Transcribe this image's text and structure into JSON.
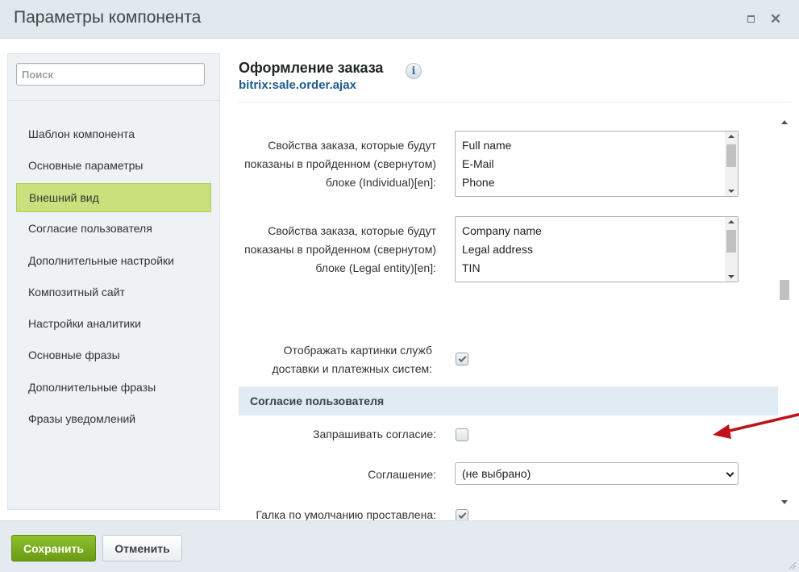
{
  "window": {
    "title": "Параметры компонента"
  },
  "sidebar": {
    "search_placeholder": "Поиск",
    "items": [
      {
        "label": "Шаблон компонента"
      },
      {
        "label": "Основные параметры"
      },
      {
        "label": "Внешний вид",
        "active": true
      },
      {
        "label": "Согласие пользователя"
      },
      {
        "label": "Дополнительные настройки"
      },
      {
        "label": "Композитный сайт"
      },
      {
        "label": "Настройки аналитики"
      },
      {
        "label": "Основные фразы"
      },
      {
        "label": "Дополнительные фразы"
      },
      {
        "label": "Фразы уведомлений"
      }
    ]
  },
  "main": {
    "component_title": "Оформление заказа",
    "component_code": "bitrix:sale.order.ajax",
    "info_icon": "i",
    "fields": {
      "individual_props": {
        "label": "Свойства заказа, которые будут показаны в пройденном (свернутом) блоке (Individual)[en]:",
        "options": [
          "Full name",
          "E-Mail",
          "Phone"
        ]
      },
      "legal_props": {
        "label": "Свойства заказа, которые будут показаны в пройденном (свернутом) блоке (Legal entity)[en]:",
        "options": [
          "Company name",
          "Legal address",
          "TIN"
        ]
      },
      "show_images": {
        "label": "Отображать картинки служб доставки и платежных систем:",
        "checked": true
      }
    },
    "section_consent": {
      "title": "Согласие пользователя",
      "request_consent": {
        "label": "Запрашивать согласие:",
        "checked": false
      },
      "agreement": {
        "label": "Соглашение:",
        "value": "(не выбрано)"
      },
      "default_checked": {
        "label": "Галка по умолчанию проставлена:",
        "checked": true
      }
    }
  },
  "footer": {
    "save_label": "Сохранить",
    "cancel_label": "Отменить"
  },
  "colors": {
    "accent_green": "#8fc02e",
    "active_nav": "#c9e07c",
    "annotation_arrow": "#c0121b",
    "link_blue": "#1f5c8c"
  }
}
